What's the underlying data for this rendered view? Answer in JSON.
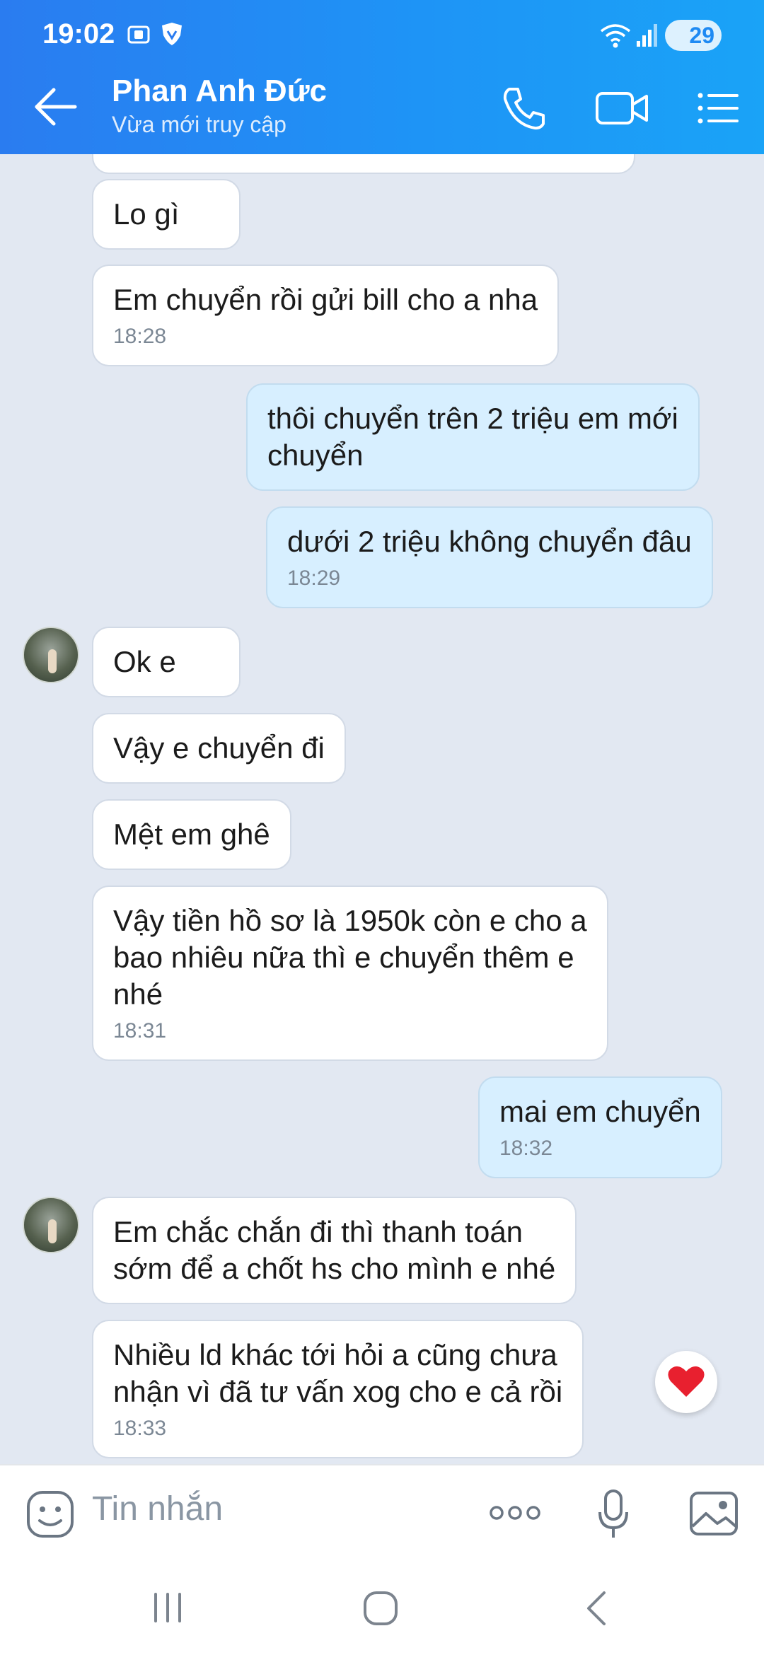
{
  "status_bar": {
    "time": "19:02",
    "battery": "29"
  },
  "header": {
    "contact_name": "Phan Anh Đức",
    "contact_status": "Vừa mới truy cập"
  },
  "messages": [
    {
      "text": "Lo gì",
      "time": ""
    },
    {
      "text": "Em chuyển rồi gửi bill cho a nha",
      "time": "18:28"
    },
    {
      "text": "thôi chuyển trên 2 triệu em mới\nchuyển",
      "time": ""
    },
    {
      "text": "dưới 2 triệu không chuyển đâu",
      "time": "18:29"
    },
    {
      "text": "Ok e",
      "time": ""
    },
    {
      "text": "Vậy e chuyển đi",
      "time": ""
    },
    {
      "text": "Mệt em ghê",
      "time": ""
    },
    {
      "text": "Vậy tiền hồ sơ là 1950k còn e cho a\nbao nhiêu nữa thì e chuyển thêm e\nnhé",
      "time": "18:31"
    },
    {
      "text": "mai em chuyển",
      "time": "18:32"
    },
    {
      "text": "Em chắc chắn đi thì thanh toán\nsớm để a chốt hs cho mình e nhé",
      "time": ""
    },
    {
      "text": "Nhiều ld khác tới hỏi a cũng chưa\nnhận vì đã tư vấn xog cho e cả rồi",
      "time": "18:33"
    }
  ],
  "input": {
    "placeholder": "Tin nhắn"
  },
  "colors": {
    "header": "#1e8af3",
    "outgoing_bubble": "#d7efff",
    "incoming_bubble": "#ffffff",
    "chat_bg": "#e2e8f2"
  }
}
